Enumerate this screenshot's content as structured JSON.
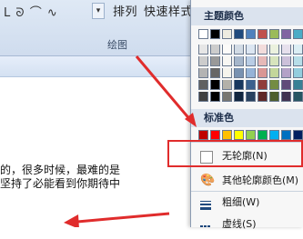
{
  "ribbon": {
    "dropdown": "▾",
    "arrange_label": "排列",
    "quick_style_label": "快速样式",
    "group_label": "绘图"
  },
  "document": {
    "line1": "的，很多时候，最难的是",
    "line2": "坚持了必能看到你期待中"
  },
  "menu": {
    "theme_colors_label": "主题颜色",
    "standard_colors_label": "标准色",
    "no_outline_label": "无轮廓(N)",
    "more_outline_colors_label": "其他轮廓颜色(M)",
    "weight_label": "粗细(W)",
    "dashes_label": "虚线(S)"
  },
  "colors": {
    "accent_red": "#e02c2c",
    "theme_row": [
      "#ffffff",
      "#000000",
      "#eeece1",
      "#1f497d",
      "#4f81bd",
      "#c0504d",
      "#9bbb59",
      "#8064a2",
      "#4bacc6",
      "#f79646"
    ],
    "standard_row": [
      "#c00000",
      "#ff0000",
      "#ffc000",
      "#ffff00",
      "#92d050",
      "#00b050",
      "#00b0f0",
      "#0070c0",
      "#002060",
      "#7030a0"
    ]
  },
  "icons": {
    "shape_tools": [
      "curve-line-icon",
      "arc-icon",
      "wave-icon"
    ],
    "more_colors": "palette-icon",
    "weight": "line-weight-icon",
    "dashes": "dash-icon"
  }
}
